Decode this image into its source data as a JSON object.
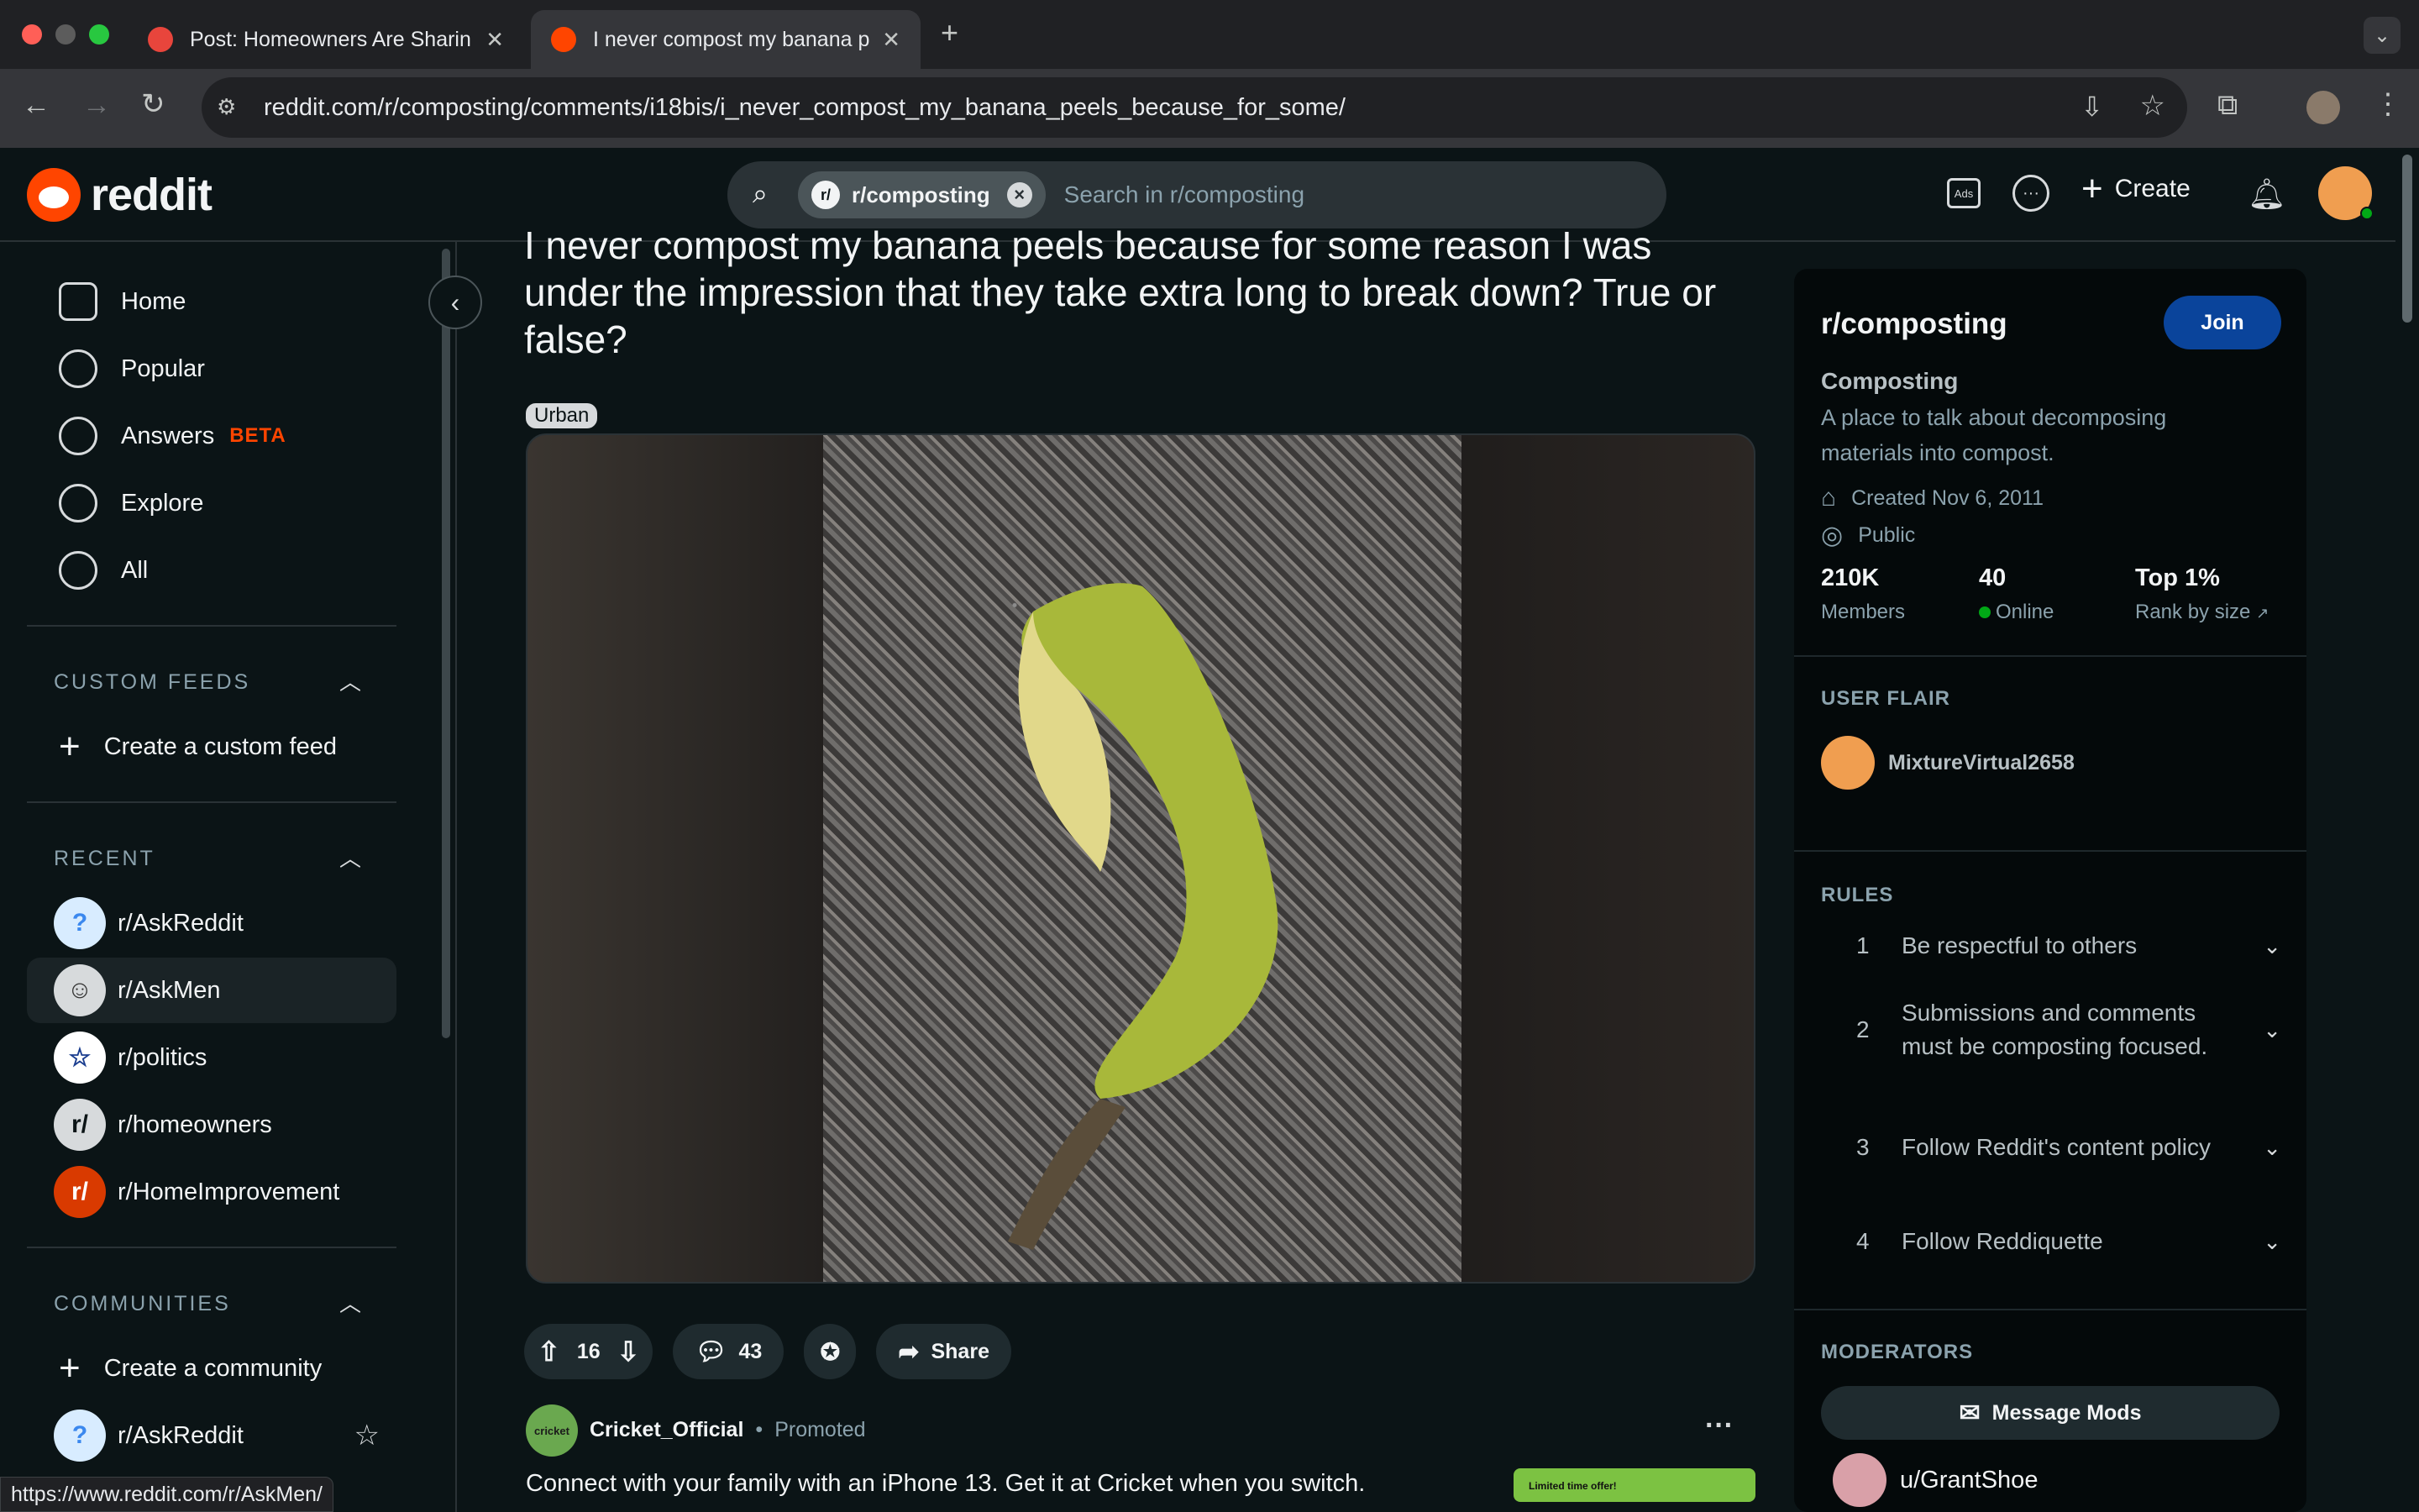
{
  "browser": {
    "tabs": [
      {
        "title": "Post: Homeowners Are Sharin",
        "active": false
      },
      {
        "title": "I never compost my banana p",
        "active": true
      }
    ],
    "url": "reddit.com/r/composting/comments/i18bis/i_never_compost_my_banana_peels_because_for_some/",
    "status_url": "https://www.reddit.com/r/AskMen/"
  },
  "header": {
    "logo_text": "reddit",
    "search_chip": "r/composting",
    "search_placeholder": "Search in r/composting",
    "create_label": "Create"
  },
  "sidebar": {
    "nav": [
      {
        "label": "Home",
        "icon": "home-icon"
      },
      {
        "label": "Popular",
        "icon": "popular-icon"
      },
      {
        "label": "Answers",
        "badge": "BETA",
        "icon": "answers-icon"
      },
      {
        "label": "Explore",
        "icon": "explore-icon"
      },
      {
        "label": "All",
        "icon": "all-icon"
      }
    ],
    "custom_feeds_title": "CUSTOM FEEDS",
    "create_custom_feed": "Create a custom feed",
    "recent_title": "RECENT",
    "recent": [
      {
        "label": "r/AskReddit",
        "color": "#3b88ee"
      },
      {
        "label": "r/AskMen",
        "color": "#d7dadc"
      },
      {
        "label": "r/politics",
        "color": "#ffffff"
      },
      {
        "label": "r/homeowners",
        "color": "#d7dadc"
      },
      {
        "label": "r/HomeImprovement",
        "color": "#d93a00"
      }
    ],
    "communities_title": "COMMUNITIES",
    "create_community": "Create a community",
    "communities": [
      {
        "label": "r/AskReddit"
      }
    ]
  },
  "post": {
    "title": "I never compost my banana peels because for some reason I was under the impression that they take extra long to break down? True or false?",
    "flair": "Urban",
    "votes": "16",
    "comments": "43",
    "share_label": "Share"
  },
  "promo": {
    "author": "Cricket_Official",
    "avatar_text": "cricket",
    "separator": "•",
    "tag": "Promoted",
    "text": "Connect with your family with an iPhone 13. Get it at Cricket when you switch.",
    "thumb_text": "Limited time offer!"
  },
  "community": {
    "name": "r/composting",
    "join_label": "Join",
    "title": "Composting",
    "description": "A place to talk about decomposing materials into compost.",
    "created": "Created Nov 6, 2011",
    "visibility": "Public",
    "stats": [
      {
        "value": "210K",
        "label": "Members"
      },
      {
        "value": "40",
        "label": "Online"
      },
      {
        "value": "Top 1%",
        "label": "Rank by size"
      }
    ],
    "user_flair_title": "USER FLAIR",
    "username": "MixtureVirtual2658",
    "rules_title": "RULES",
    "rules": [
      {
        "n": "1",
        "text": "Be respectful to others"
      },
      {
        "n": "2",
        "text": "Submissions and comments must be composting focused."
      },
      {
        "n": "3",
        "text": "Follow Reddit's content policy"
      },
      {
        "n": "4",
        "text": "Follow Reddiquette"
      }
    ],
    "moderators_title": "MODERATORS",
    "message_mods": "Message Mods",
    "moderator": "u/GrantShoe"
  },
  "colors": {
    "accent_orange": "#ff4500",
    "join_blue": "#0a449b",
    "online_green": "#01a816",
    "beta_red": "#ff4500"
  }
}
